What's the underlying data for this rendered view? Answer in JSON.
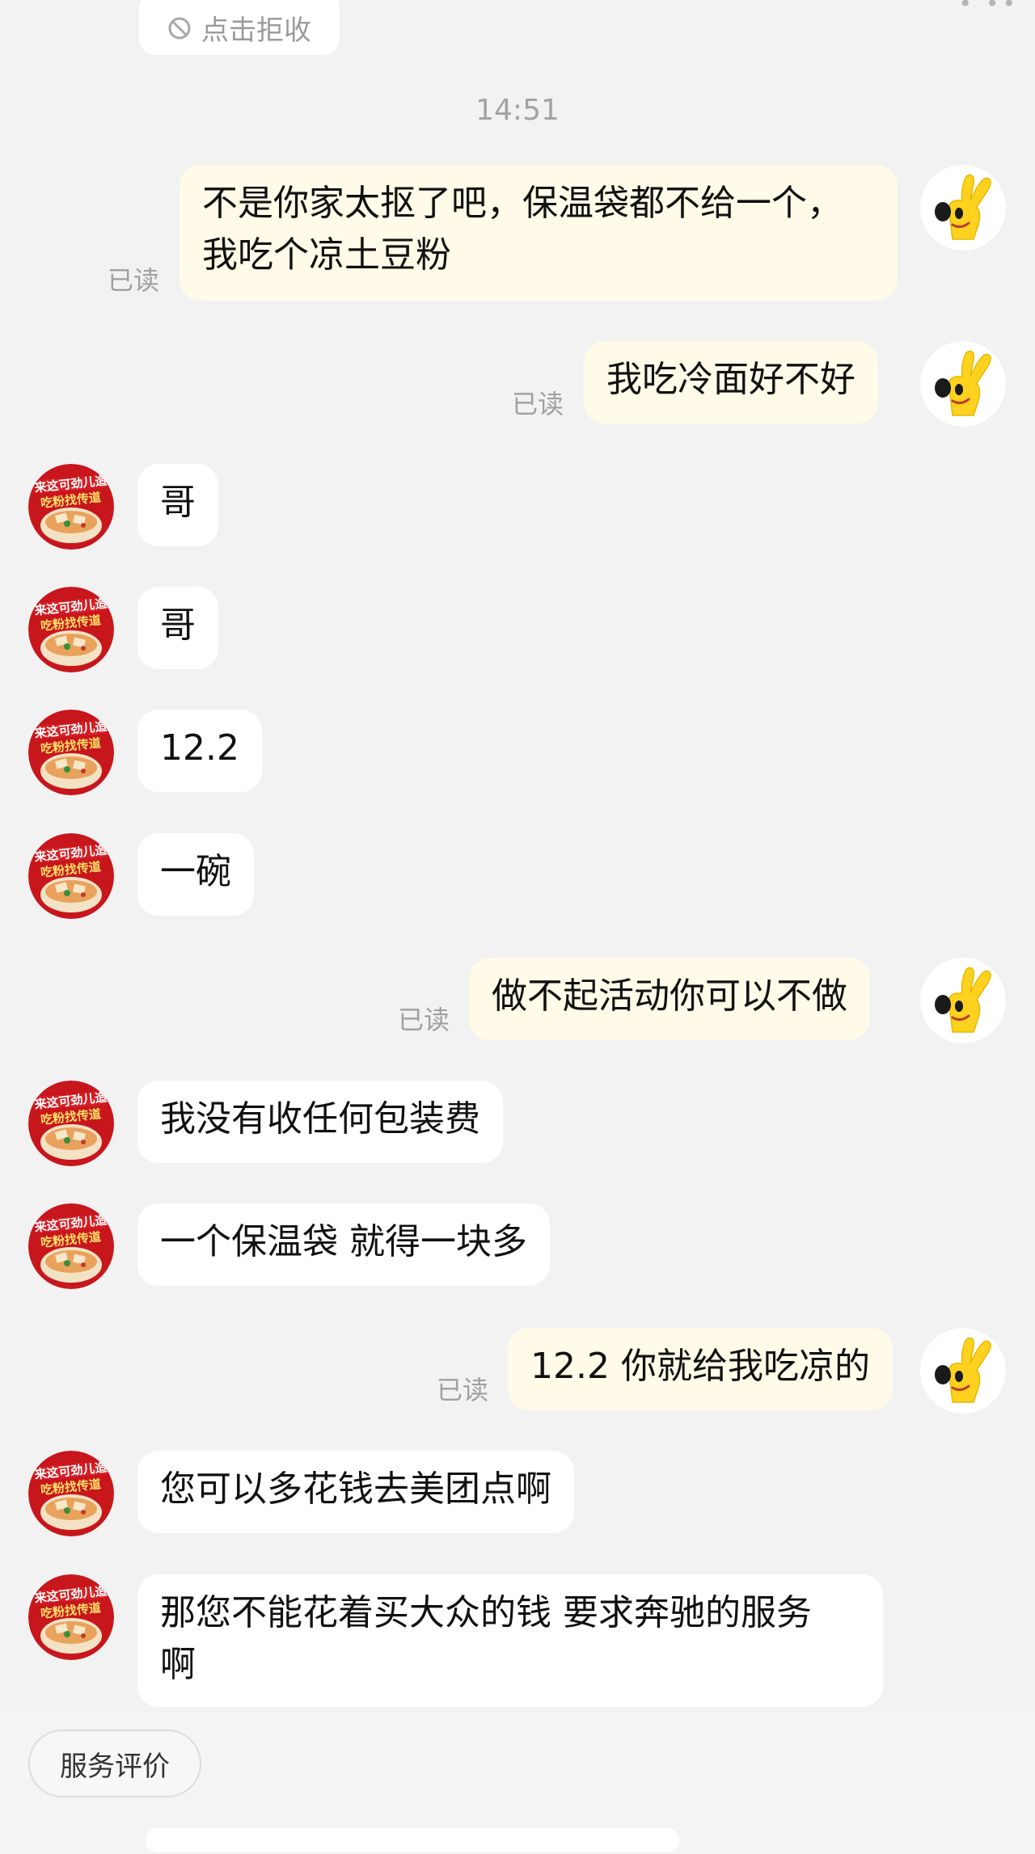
{
  "notice": {
    "text": "点击拒收",
    "icon": "blocked-icon"
  },
  "top_fragment": "• ••",
  "timestamp": "14:51",
  "read_label": "已读",
  "messages": [
    {
      "side": "out",
      "lines": [
        "不是你家太抠了吧，保温袋都不给一个，",
        "我吃个凉土豆粉"
      ],
      "read": "已读"
    },
    {
      "side": "out",
      "lines": [
        "我吃冷面好不好"
      ],
      "read": "已读"
    },
    {
      "side": "in",
      "lines": [
        "哥"
      ]
    },
    {
      "side": "in",
      "lines": [
        "哥"
      ]
    },
    {
      "side": "in",
      "lines": [
        "12.2"
      ]
    },
    {
      "side": "in",
      "lines": [
        "一碗"
      ]
    },
    {
      "side": "out",
      "lines": [
        "做不起活动你可以不做"
      ],
      "read": "已读"
    },
    {
      "side": "in",
      "lines": [
        "我没有收任何包装费"
      ]
    },
    {
      "side": "in",
      "lines": [
        "一个保温袋 就得一块多"
      ]
    },
    {
      "side": "out",
      "lines": [
        "12.2 你就给我吃凉的"
      ],
      "read": "已读"
    },
    {
      "side": "in",
      "lines": [
        "您可以多花钱去美团点啊"
      ]
    },
    {
      "side": "in",
      "lines": [
        "那您不能花着买大众的钱 要求奔驰的服务",
        "啊"
      ]
    }
  ],
  "avatars": {
    "self": "hand-victory-mascot-icon",
    "merchant": "noodle-shop-logo-icon"
  },
  "merchant_logo_text": [
    "来这可劲儿造",
    "吃粉找传道"
  ],
  "colors": {
    "background": "#f2f2f2",
    "outgoing_bubble": "#fffbe8",
    "incoming_bubble": "#ffffff",
    "read_text": "#a0a0a0",
    "mascot_yellow": "#ffd21f",
    "logo_red": "#c8161d"
  },
  "bottom": {
    "rate_button": "服务评价"
  }
}
